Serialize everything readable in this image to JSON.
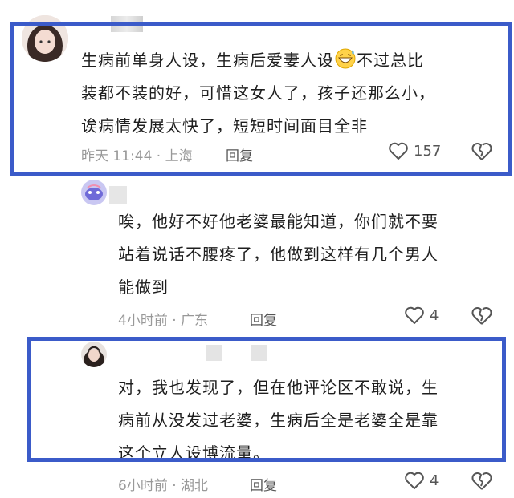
{
  "comments": [
    {
      "text_lines": [
        "生病前单身人设，生病后爱妻人设",
        "装都不装的好，可惜这女人了，孩子还那么小，",
        "诶病情发展太快了，短短时间面目全非"
      ],
      "text_line1_after_emoji": "不过总比",
      "emoji": "grinning-sweat-emoji",
      "meta": "昨天 11:44 · 上海",
      "reply": "回复",
      "likes": "157"
    },
    {
      "text_lines": [
        "唉，他好不好他老婆最能知道，你们就不要",
        "站着说话不腰疼了，他做到这样有几个男人",
        "能做到"
      ],
      "meta": "4小时前 · 广东",
      "reply": "回复",
      "likes": "4"
    },
    {
      "text_lines": [
        "对，我也发现了，但在他评论区不敢说，生",
        "病前从没发过老婆，生病后全是老婆全是靠",
        "这个立人设博流量。"
      ],
      "meta": "6小时前 · 湖北",
      "reply": "回复",
      "likes": "4"
    }
  ],
  "colors": {
    "highlight_frame": "#3b5bc9",
    "meta_text": "#999999"
  }
}
